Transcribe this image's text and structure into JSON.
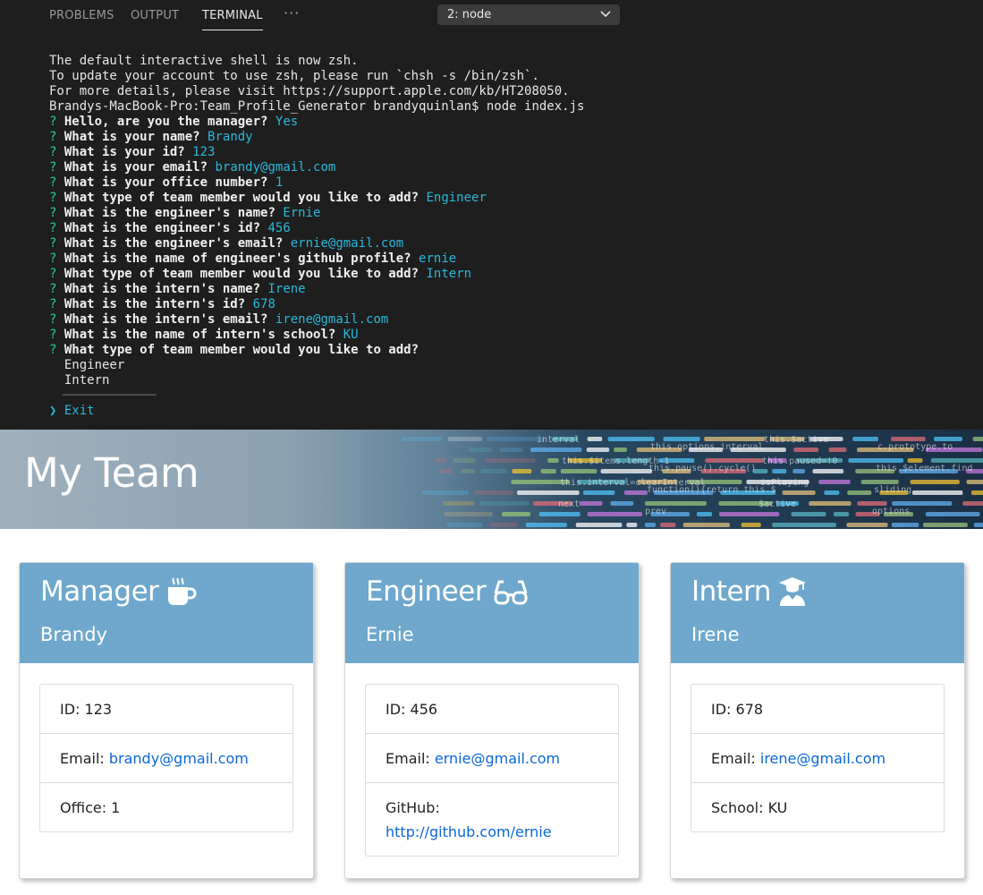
{
  "panel": {
    "tabs": [
      {
        "label": "PROBLEMS"
      },
      {
        "label": "OUTPUT"
      },
      {
        "label": "TERMINAL"
      }
    ],
    "more_label": "···",
    "terminal_select": "2: node"
  },
  "terminal": {
    "lines": [
      {
        "plain": "The default interactive shell is now zsh."
      },
      {
        "plain": "To update your account to use zsh, please run `chsh -s /bin/zsh`."
      },
      {
        "plain": "For more details, please visit https://support.apple.com/kb/HT208050."
      },
      {
        "plain": "Brandys-MacBook-Pro:Team_Profile_Generator brandyquinlan$ node index.js"
      },
      {
        "q": "?",
        "text": "Hello, are you the manager?",
        "ans": "Yes"
      },
      {
        "q": "?",
        "text": "What is your name?",
        "ans": "Brandy"
      },
      {
        "q": "?",
        "text": "What is your id?",
        "ans": "123"
      },
      {
        "q": "?",
        "text": "What is your email?",
        "ans": "brandy@gmail.com"
      },
      {
        "q": "?",
        "text": "What is your office number?",
        "ans": "1"
      },
      {
        "q": "?",
        "text": "What type of team member would you like to add?",
        "ans": "Engineer"
      },
      {
        "q": "?",
        "text": "What is the engineer's name?",
        "ans": "Ernie"
      },
      {
        "q": "?",
        "text": "What is the engineer's id?",
        "ans": "456"
      },
      {
        "q": "?",
        "text": "What is the engineer's email?",
        "ans": "ernie@gmail.com"
      },
      {
        "q": "?",
        "text": "What is the name of engineer's github profile?",
        "ans": "ernie"
      },
      {
        "q": "?",
        "text": "What type of team member would you like to add?",
        "ans": "Intern"
      },
      {
        "q": "?",
        "text": "What is the intern's name?",
        "ans": "Irene"
      },
      {
        "q": "?",
        "text": "What is the intern's id?",
        "ans": "678"
      },
      {
        "q": "?",
        "text": "What is the intern's email?",
        "ans": "irene@gmail.com"
      },
      {
        "q": "?",
        "text": "What is the name of intern's school?",
        "ans": "KU"
      },
      {
        "q": "?",
        "text": "What type of team member would you like to add?",
        "ans": ""
      },
      {
        "opt": "  Engineer"
      },
      {
        "opt": "  Intern"
      },
      {
        "sep": "  ──────────────"
      },
      {
        "selected": "❯ Exit"
      }
    ]
  },
  "hero": {
    "title": "My Team",
    "code_snippets": [
      "interval",
      "this.options.interval",
      "this.$active",
      "c.prototype.to",
      "this.$items.length-1",
      "this.pause().cycle()",
      "this.paused=!0",
      "this.$element.find",
      "this.interval=clearInterval",
      "function(){return this.$",
      "isPlaying",
      "sliding",
      "next",
      "prev",
      "$active",
      "options"
    ]
  },
  "colors": {
    "terminal_bg": "#1e1e1e",
    "prompt_green": "#23d18b",
    "answer_cyan": "#29b8db",
    "card_header": "#6fa8cc",
    "link": "#0a66d8"
  },
  "cards": [
    {
      "role": "Manager",
      "icon": "mug-icon",
      "name": "Brandy",
      "id_text": "ID: 123",
      "email_label": "Email: ",
      "email": "brandy@gmail.com",
      "extra_label": "Office: 1",
      "extra_link": ""
    },
    {
      "role": "Engineer",
      "icon": "glasses-icon",
      "name": "Ernie",
      "id_text": "ID: 456",
      "email_label": "Email: ",
      "email": "ernie@gmail.com",
      "extra_label": "GitHub:",
      "extra_link": "http://github.com/ernie"
    },
    {
      "role": "Intern",
      "icon": "graduate-icon",
      "name": "Irene",
      "id_text": "ID: 678",
      "email_label": "Email: ",
      "email": "irene@gmail.com",
      "extra_label": "School: KU",
      "extra_link": ""
    }
  ]
}
